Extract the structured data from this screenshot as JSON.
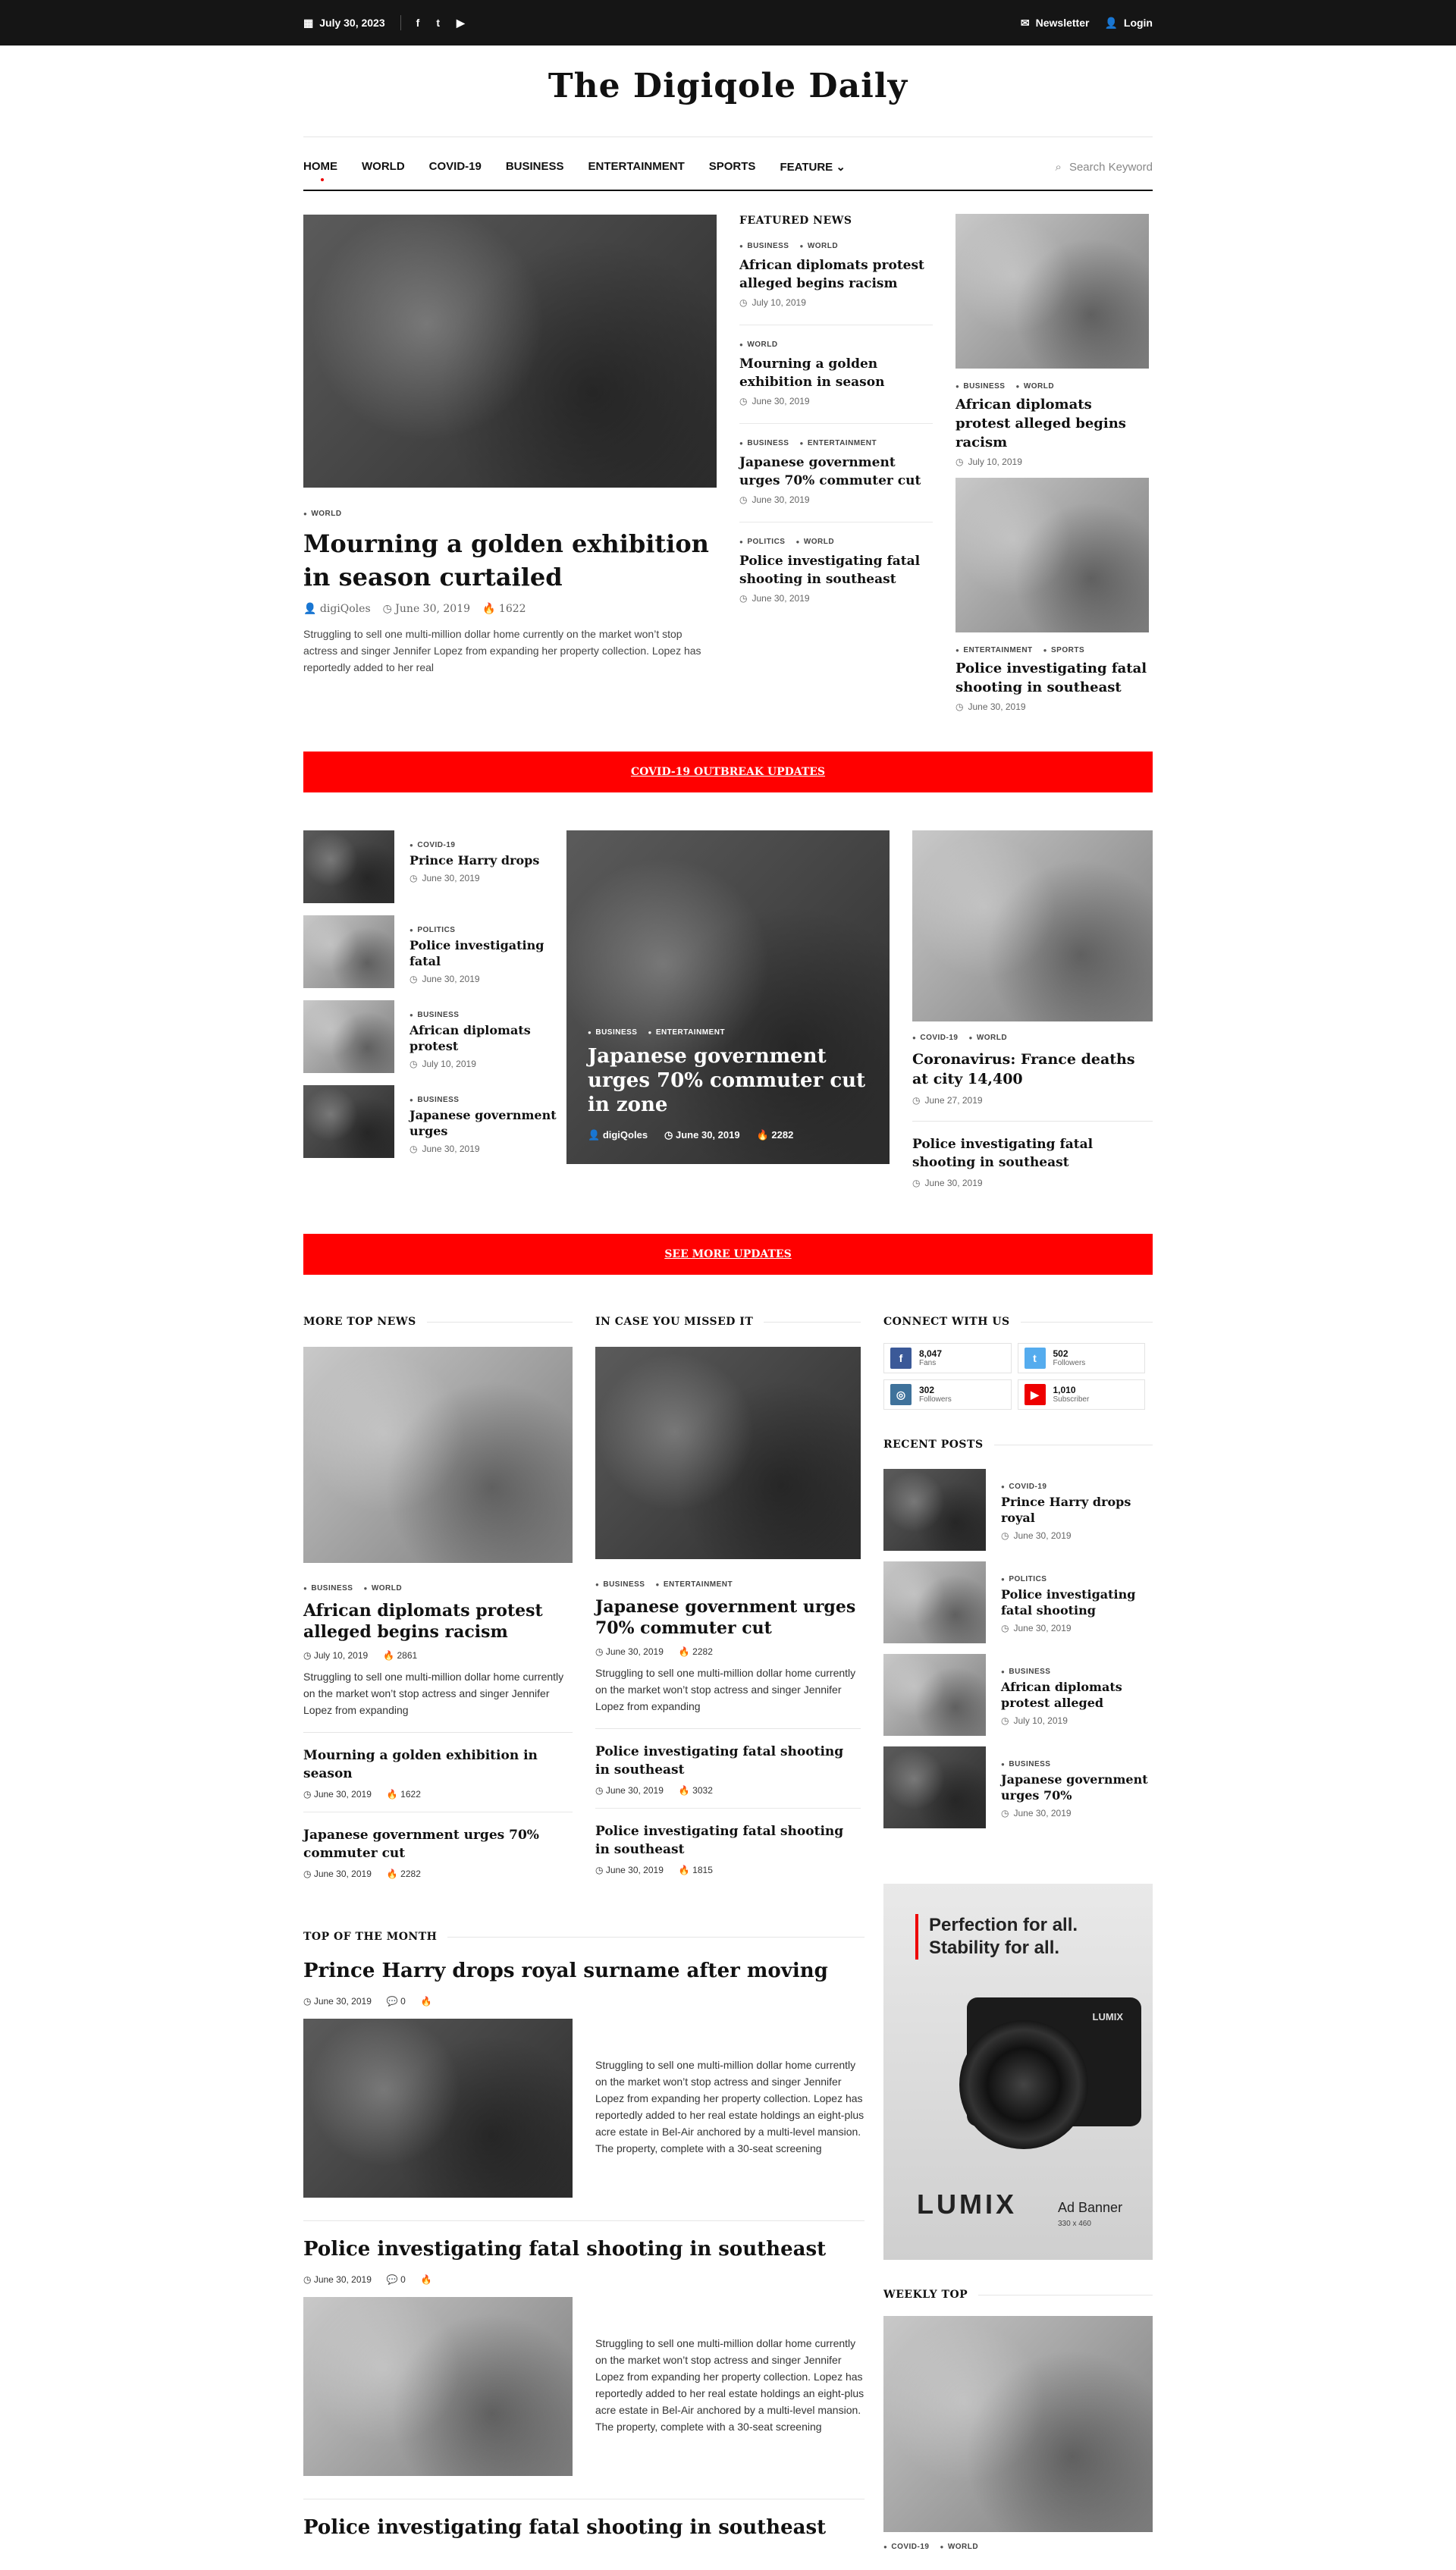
{
  "topbar": {
    "date": "July 30, 2023",
    "newsletter": "Newsletter",
    "login": "Login"
  },
  "site": {
    "logo": "The Digiqole Daily"
  },
  "nav": {
    "items": [
      "HOME",
      "WORLD",
      "COVID-19",
      "BUSINESS",
      "ENTERTAINMENT",
      "SPORTS",
      "FEATURE"
    ],
    "search_placeholder": "Search Keyword"
  },
  "hero": {
    "category": "WORLD",
    "title": "Mourning a golden exhibition in season curtailed",
    "author": "digiQoles",
    "date": "June 30, 2019",
    "views": "1622",
    "excerpt": "Struggling to sell one multi-million dollar home currently on the market won’t stop actress and singer Jennifer Lopez from expanding her property collection. Lopez has reportedly added to her real"
  },
  "featured": {
    "label": "FEATURED NEWS",
    "items": [
      {
        "cats": [
          "BUSINESS",
          "WORLD"
        ],
        "title": "African diplomats protest alleged begins racism",
        "date": "July 10, 2019"
      },
      {
        "cats": [
          "WORLD"
        ],
        "title": "Mourning a golden exhibition in season",
        "date": "June 30, 2019"
      },
      {
        "cats": [
          "BUSINESS",
          "ENTERTAINMENT"
        ],
        "title": "Japanese government urges 70% commuter cut",
        "date": "June 30, 2019"
      },
      {
        "cats": [
          "POLITICS",
          "WORLD"
        ],
        "title": "Police investigating fatal shooting in southeast",
        "date": "June 30, 2019"
      }
    ]
  },
  "right_cards": [
    {
      "cats": [
        "BUSINESS",
        "WORLD"
      ],
      "title": "African diplomats protest alleged begins racism",
      "date": "July 10, 2019"
    },
    {
      "cats": [
        "ENTERTAINMENT",
        "SPORTS"
      ],
      "title": "Police investigating fatal shooting in southeast",
      "date": "June 30, 2019"
    }
  ],
  "banner1": "COVID-19 OUTBREAK UPDATES",
  "small_list": [
    {
      "cat": "COVID-19",
      "title": "Prince Harry drops",
      "date": "June 30, 2019"
    },
    {
      "cat": "POLITICS",
      "title": "Police investigating fatal",
      "date": "June 30, 2019"
    },
    {
      "cat": "BUSINESS",
      "title": "African diplomats protest",
      "date": "July 10, 2019"
    },
    {
      "cat": "BUSINESS",
      "title": "Japanese government urges",
      "date": "June 30, 2019"
    }
  ],
  "big_card": {
    "cats": [
      "BUSINESS",
      "ENTERTAINMENT"
    ],
    "title": "Japanese government urges 70% commuter cut in zone",
    "author": "digiQoles",
    "date": "June 30, 2019",
    "views": "2282"
  },
  "rc2": {
    "cats": [
      "COVID-19",
      "WORLD"
    ],
    "title": "Coronavirus: France deaths at city 14,400",
    "date": "June 27, 2019",
    "second_title": "Police investigating fatal shooting in southeast",
    "second_date": "June 30, 2019"
  },
  "banner2": "SEE MORE UPDATES",
  "more_top": {
    "label": "MORE TOP NEWS",
    "main": {
      "cats": [
        "BUSINESS",
        "WORLD"
      ],
      "title": "African diplomats protest alleged begins racism",
      "date": "July 10, 2019",
      "views": "2861",
      "excerpt": "Struggling to sell one multi-million dollar home currently on the market won’t stop actress and singer Jennifer Lopez from expanding"
    },
    "list": [
      {
        "title": "Mourning a golden exhibition in season",
        "date": "June 30, 2019",
        "views": "1622"
      },
      {
        "title": "Japanese government urges 70% commuter cut",
        "date": "June 30, 2019",
        "views": "2282"
      }
    ]
  },
  "missed": {
    "label": "IN CASE YOU MISSED IT",
    "main": {
      "cats": [
        "BUSINESS",
        "ENTERTAINMENT"
      ],
      "title": "Japanese government urges 70% commuter cut",
      "date": "June 30, 2019",
      "views": "2282",
      "excerpt": "Struggling to sell one multi-million dollar home currently on the market won’t stop actress and singer Jennifer Lopez from expanding"
    },
    "list": [
      {
        "title": "Police investigating fatal shooting in southeast",
        "date": "June 30, 2019",
        "views": "3032"
      },
      {
        "title": "Police investigating fatal shooting in southeast",
        "date": "June 30, 2019",
        "views": "1815"
      }
    ]
  },
  "connect": {
    "label": "CONNECT WITH US",
    "items": [
      {
        "icon": "facebook-icon",
        "glyph": "f",
        "color": "#3b5998",
        "count": "8,047",
        "label": "Fans"
      },
      {
        "icon": "twitter-icon",
        "glyph": "t",
        "color": "#55acee",
        "count": "502",
        "label": "Followers"
      },
      {
        "icon": "instagram-icon",
        "glyph": "◎",
        "color": "#3f729b",
        "count": "302",
        "label": "Followers"
      },
      {
        "icon": "youtube-icon",
        "glyph": "▶",
        "color": "#e00",
        "count": "1,010",
        "label": "Subscriber"
      }
    ]
  },
  "recent": {
    "label": "RECENT POSTS",
    "items": [
      {
        "cat": "COVID-19",
        "title": "Prince Harry drops royal",
        "date": "June 30, 2019"
      },
      {
        "cat": "POLITICS",
        "title": "Police investigating fatal shooting",
        "date": "June 30, 2019"
      },
      {
        "cat": "BUSINESS",
        "title": "African diplomats protest alleged",
        "date": "July 10, 2019"
      },
      {
        "cat": "BUSINESS",
        "title": "Japanese government urges 70%",
        "date": "June 30, 2019"
      }
    ]
  },
  "ad": {
    "line1": "Perfection for all.",
    "line2": "Stability for all.",
    "camera_brand": "LUMIX",
    "brand": "LUMIX",
    "label": "Ad Banner",
    "size": "330 x 460"
  },
  "top_month": {
    "label": "TOP OF THE MONTH",
    "articles": [
      {
        "title": "Prince Harry drops royal surname after moving",
        "date": "June 30, 2019",
        "comments": "0",
        "excerpt": "Struggling to sell one multi-million dollar home currently on the market won’t stop actress and singer Jennifer Lopez from expanding her property collection. Lopez has reportedly added to her real estate holdings an eight-plus acre estate in Bel-Air anchored by a multi-level mansion. The property, complete with a 30-seat screening"
      },
      {
        "title": "Police investigating fatal shooting in southeast",
        "date": "June 30, 2019",
        "comments": "0",
        "excerpt": "Struggling to sell one multi-million dollar home currently on the market won’t stop actress and singer Jennifer Lopez from expanding her property collection. Lopez has reportedly added to her real estate holdings an eight-plus acre estate in Bel-Air anchored by a multi-level mansion. The property, complete with a 30-seat screening"
      }
    ],
    "third_title": "Police investigating fatal shooting in southeast"
  },
  "weekly": {
    "label": "WEEKLY TOP",
    "cats": [
      "COVID-19",
      "WORLD"
    ]
  }
}
